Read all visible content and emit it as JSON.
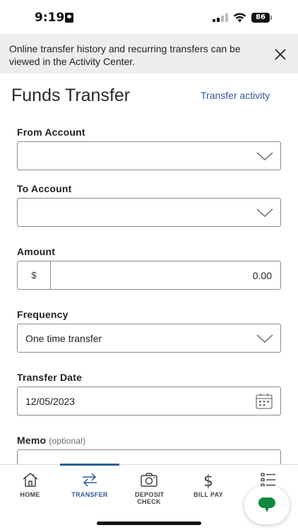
{
  "status_bar": {
    "time": "9:19",
    "battery": "86"
  },
  "banner": {
    "message": "Online transfer history and recurring transfers can be viewed in the Activity Center."
  },
  "header": {
    "title": "Funds Transfer",
    "activity_link": "Transfer activity"
  },
  "form": {
    "from_account": {
      "label": "From Account",
      "value": ""
    },
    "to_account": {
      "label": "To Account",
      "value": ""
    },
    "amount": {
      "label": "Amount",
      "currency": "$",
      "value": "0.00"
    },
    "frequency": {
      "label": "Frequency",
      "value": "One time transfer"
    },
    "transfer_date": {
      "label": "Transfer Date",
      "value": "12/05/2023"
    },
    "memo": {
      "label": "Memo",
      "optional": "(optional)",
      "value": ""
    }
  },
  "nav": {
    "items": [
      {
        "label": "HOME",
        "icon": "home-icon"
      },
      {
        "label": "TRANSFER",
        "icon": "transfer-arrows-icon",
        "active": true
      },
      {
        "label": "DEPOSIT CHECK",
        "icon": "camera-icon"
      },
      {
        "label": "BILL PAY",
        "icon": "dollar-icon"
      },
      {
        "label": "",
        "icon": "list-menu-icon"
      }
    ]
  },
  "colors": {
    "accent": "#2e5d99",
    "chat": "#0e8a3e",
    "banner_bg": "#eeeeee"
  }
}
